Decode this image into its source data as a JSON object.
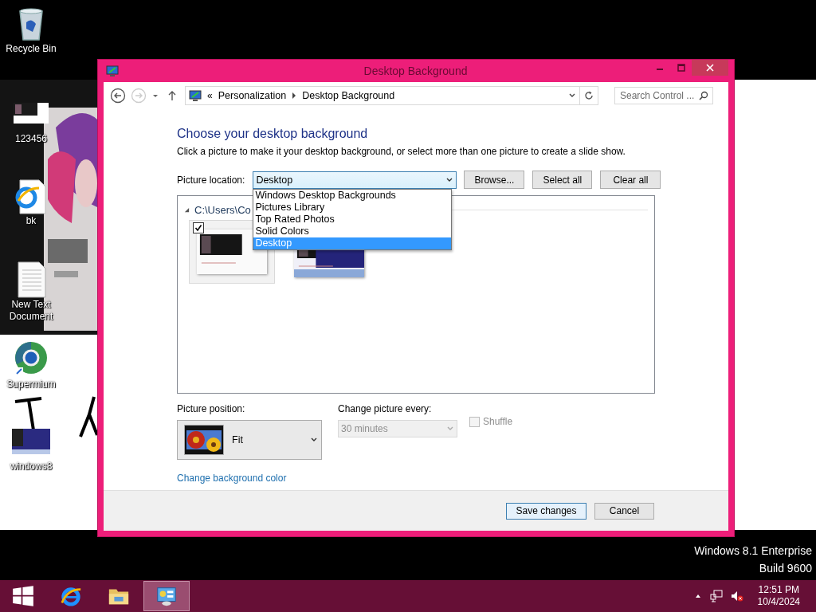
{
  "desktop": {
    "icons": [
      {
        "label": "Recycle Bin",
        "kind": "recycle-bin"
      },
      {
        "label": "123456",
        "kind": "image-file"
      },
      {
        "label": "bk",
        "kind": "web-file"
      },
      {
        "label": "New Text\nDocument",
        "kind": "text-file"
      },
      {
        "label": "Supermium",
        "kind": "browser"
      },
      {
        "label": "windows8",
        "kind": "screenshot"
      }
    ],
    "watermark": [
      "Windows 8.1 Enterprise",
      "Build 9600"
    ]
  },
  "window": {
    "title": "Desktop Background",
    "address": {
      "prefix": "«",
      "breadcrumb": [
        "Personalization",
        "Desktop Background"
      ]
    },
    "search": {
      "placeholder": "Search Control ..."
    },
    "heading": "Choose your desktop background",
    "description": "Click a picture to make it your desktop background, or select more than one picture to create a slide show.",
    "location": {
      "label": "Picture location:",
      "value": "Desktop",
      "options": [
        {
          "label": "Windows Desktop Backgrounds",
          "selected": false
        },
        {
          "label": "Pictures Library",
          "selected": false
        },
        {
          "label": "Top Rated Photos",
          "selected": false
        },
        {
          "label": "Solid Colors",
          "selected": false
        },
        {
          "label": "Desktop",
          "selected": true
        }
      ]
    },
    "buttons": [
      "Browse...",
      "Select all",
      "Clear all"
    ],
    "folder": {
      "path": "C:\\Users\\Co",
      "expanded": true
    },
    "thumbnails": [
      {
        "kind": "picture",
        "checked": true
      },
      {
        "kind": "picture",
        "checked": false
      }
    ],
    "position": {
      "label": "Picture position:",
      "value": "Fit"
    },
    "interval": {
      "label": "Change picture every:",
      "value": "30 minutes",
      "disabled": true
    },
    "shuffle": {
      "label": "Shuffle",
      "checked": false,
      "disabled": true
    },
    "link": "Change background color",
    "footer": [
      {
        "label": "Save changes",
        "default": true
      },
      {
        "label": "Cancel",
        "default": false
      }
    ]
  },
  "taskbar": {
    "apps": [
      {
        "kind": "start",
        "selected": false
      },
      {
        "kind": "ie",
        "selected": false
      },
      {
        "kind": "explorer",
        "selected": false
      },
      {
        "kind": "control-panel",
        "selected": true
      }
    ],
    "time": "12:51 PM",
    "date": "10/4/2024"
  }
}
